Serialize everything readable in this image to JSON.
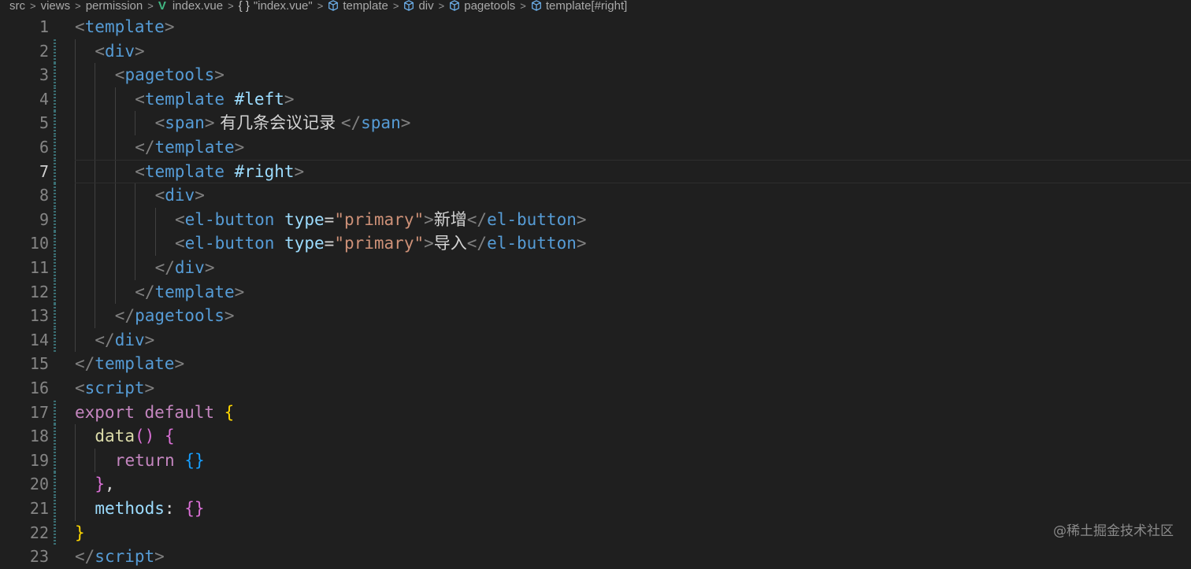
{
  "breadcrumb": {
    "items": [
      "src",
      "views",
      "permission",
      "index.vue",
      "\"index.vue\"",
      "template",
      "div",
      "pagetools",
      "template[#right]"
    ],
    "separator": ">"
  },
  "editor": {
    "current_line": 7,
    "lines": [
      {
        "n": "1",
        "text_tokens": [
          "<",
          "template",
          ">"
        ]
      },
      {
        "n": "2",
        "text_tokens": [
          "<",
          "div",
          ">"
        ]
      },
      {
        "n": "3",
        "text_tokens": [
          "<",
          "pagetools",
          ">"
        ]
      },
      {
        "n": "4",
        "text_tokens": [
          "<",
          "template",
          " #left",
          ">"
        ]
      },
      {
        "n": "5",
        "text_tokens": [
          "<",
          "span",
          ">",
          " 有几条会议记录 ",
          "</",
          "span",
          ">"
        ]
      },
      {
        "n": "6",
        "text_tokens": [
          "</",
          "template",
          ">"
        ]
      },
      {
        "n": "7",
        "text_tokens": [
          "<",
          "template",
          " #right",
          ">"
        ]
      },
      {
        "n": "8",
        "text_tokens": [
          "<",
          "div",
          ">"
        ]
      },
      {
        "n": "9",
        "text_tokens": [
          "<",
          "el-button",
          " type",
          "=",
          "\"primary\"",
          ">",
          "新增",
          "</",
          "el-button",
          ">"
        ]
      },
      {
        "n": "10",
        "text_tokens": [
          "<",
          "el-button",
          " type",
          "=",
          "\"primary\"",
          ">",
          "导入",
          "</",
          "el-button",
          ">"
        ]
      },
      {
        "n": "11",
        "text_tokens": [
          "</",
          "div",
          ">"
        ]
      },
      {
        "n": "12",
        "text_tokens": [
          "</",
          "template",
          ">"
        ]
      },
      {
        "n": "13",
        "text_tokens": [
          "</",
          "pagetools",
          ">"
        ]
      },
      {
        "n": "14",
        "text_tokens": [
          "</",
          "div",
          ">"
        ]
      },
      {
        "n": "15",
        "text_tokens": [
          "</",
          "template",
          ">"
        ]
      },
      {
        "n": "16",
        "text_tokens": [
          "<",
          "script",
          ">"
        ]
      },
      {
        "n": "17",
        "text_tokens": [
          "export",
          " default",
          " ",
          "{"
        ]
      },
      {
        "n": "18",
        "text_tokens": [
          "data",
          "(",
          ")",
          " ",
          "{"
        ]
      },
      {
        "n": "19",
        "text_tokens": [
          "return",
          " ",
          "{}"
        ]
      },
      {
        "n": "20",
        "text_tokens": [
          "}",
          ","
        ]
      },
      {
        "n": "21",
        "text_tokens": [
          "methods",
          ": ",
          "{}"
        ]
      },
      {
        "n": "22",
        "text_tokens": [
          "}"
        ]
      },
      {
        "n": "23",
        "text_tokens": [
          "</",
          "script",
          ">"
        ]
      }
    ]
  },
  "watermark": "@稀土掘金技术社区",
  "colors": {
    "background": "#1f1f1f",
    "tag": "#569cd6",
    "attribute": "#9cdcfe",
    "string": "#ce9178",
    "keyword": "#c586c0",
    "function": "#dcdcaa",
    "bracket_gold": "#ffd700",
    "bracket_pink": "#da70d6",
    "bracket_blue": "#179fff",
    "gutter_modified": "#3a6f74"
  },
  "icons": [
    "vue-file-icon",
    "json-braces-icon",
    "symbol-cube-icon"
  ]
}
